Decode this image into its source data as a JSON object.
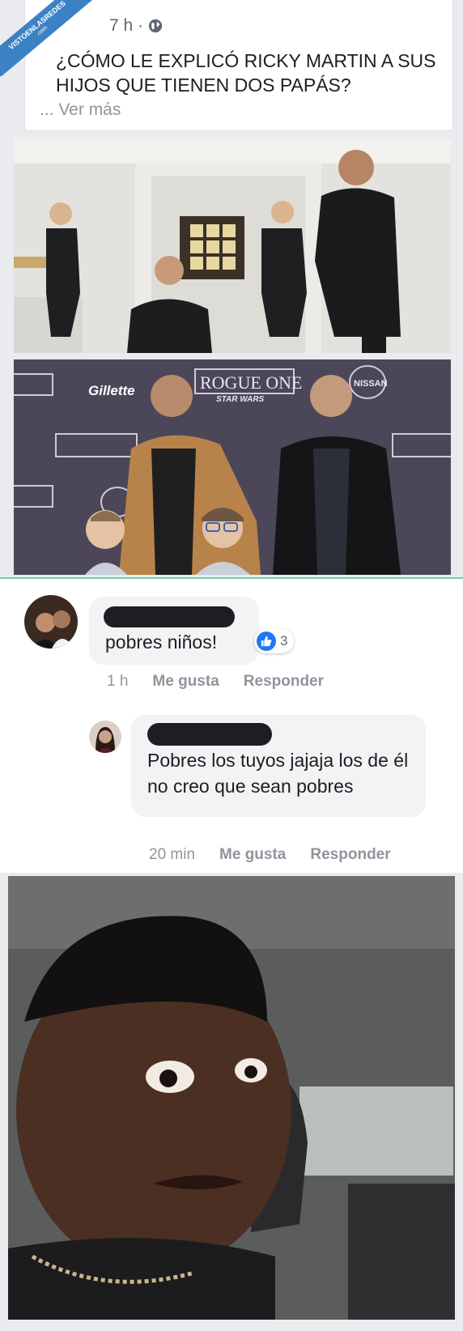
{
  "watermark": {
    "line1": "VISTOENLASREDES",
    "line2": ".com"
  },
  "post": {
    "time": "7 h ·",
    "text": "¿CÓMO LE EXPLICÓ RICKY MARTIN A SUS HIJOS QUE TIENEN DOS PAPÁS?",
    "see_more": "... Ver más"
  },
  "banner": {
    "brand": "Gillette",
    "film": "ROGUE ONE",
    "subtitle": "STAR WARS",
    "sponsor": "NISSAN"
  },
  "comments": [
    {
      "text": "pobres niños!",
      "likes": "3",
      "time": "1 h",
      "like_label": "Me gusta",
      "reply_label": "Responder"
    },
    {
      "text": "Pobres los tuyos jajaja los de él no creo que sean pobres",
      "time": "20 min",
      "like_label": "Me gusta",
      "reply_label": "Responder"
    }
  ],
  "colors": {
    "facebook_blue": "#2078f4",
    "bubble": "#f2f3f5"
  }
}
